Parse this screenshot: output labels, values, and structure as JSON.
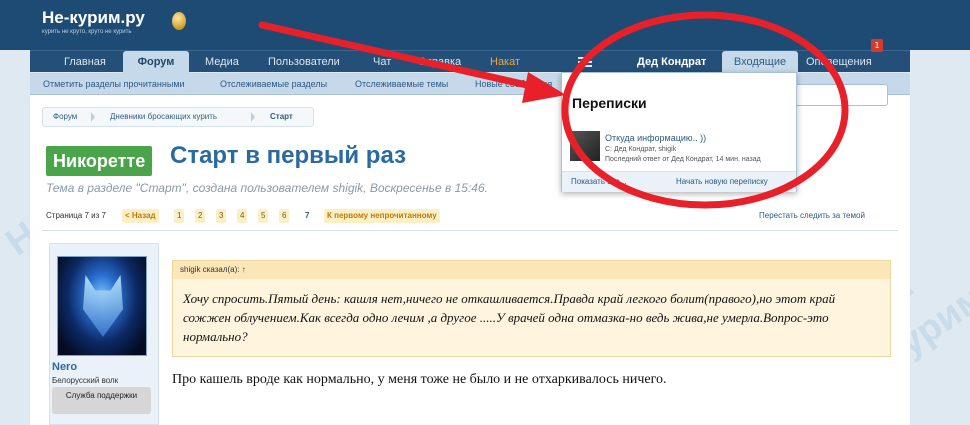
{
  "site": {
    "logo": "Не-курим.ру",
    "slogan": "курить не круто, круто не курить",
    "watermark": "Не-курим.ру"
  },
  "nav": {
    "tabs": [
      "Главная",
      "Форум",
      "Медиа",
      "Пользователи",
      "Чат",
      "Справка",
      "Накат"
    ],
    "user": "Дед Кондрат",
    "inbox": "Входящие",
    "alerts": "Оповещения",
    "alerts_count": "1"
  },
  "subnav": [
    "Отметить разделы прочитанными",
    "Отслеживаемые разделы",
    "Отслеживаемые темы",
    "Новые сообщения"
  ],
  "breadcrumb": [
    "Форум",
    "Дневники бросающих курить",
    "Старт"
  ],
  "thread": {
    "prefix": "Никоретте",
    "title": "Старт в первый раз",
    "meta": "Тема в разделе \"Старт\", создана пользователем shigik, Воскресенье в 15:46."
  },
  "pager": {
    "label": "Страница 7 из 7",
    "prev": "< Назад",
    "pages": [
      "1",
      "2",
      "3",
      "4",
      "5",
      "6",
      "7"
    ],
    "unread": "К первому непрочитанному",
    "unwatch": "Перестать следить за темой"
  },
  "post": {
    "username": "Nero",
    "user_title": "Белорусский волк",
    "role": "Служба поддержки",
    "quote_author": "shigik сказал(а): ↑",
    "quote_text": "Хочу спросить.Пятый день: кашля нет,ничего не откашливается.Правда край легкого болит(правого),но этот край сожжен облучением.Как всегда одно лечим ,а другое .....У врачей одна отмазка-но ведь жива,не умерла.Вопрос-это нормально?",
    "text": "Про кашель вроде как нормально, у меня тоже не было и не отхаркивалось ничего."
  },
  "popup": {
    "title": "Переписки",
    "subject": "Откуда информацию.. ))",
    "from": "С: Дед Кондрат, shigik",
    "last": "Последний ответ от Дед Кондрат, 14 мин. назад",
    "show_all": "Показать все...",
    "new": "Начать новую переписку"
  },
  "colors": {
    "header": "#1e4b73",
    "accent": "#2b6aa0",
    "prefix": "#4aa44a",
    "annotation": "#e8202a"
  },
  "annotations": {
    "arrow": "red-arrow",
    "circle": "red-ellipse"
  }
}
